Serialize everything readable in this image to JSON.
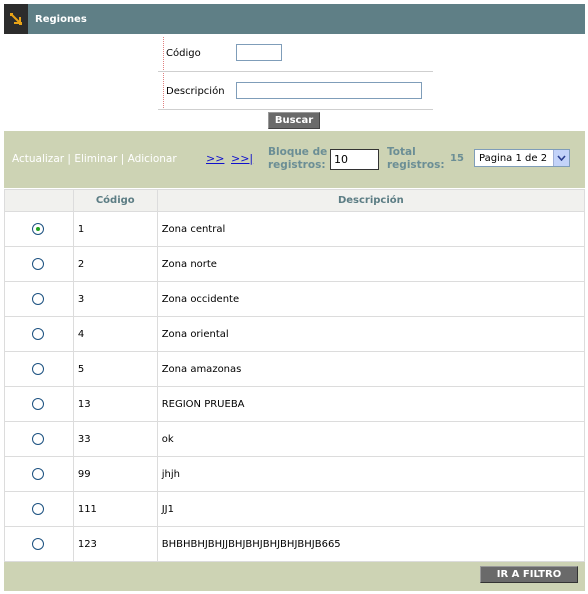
{
  "header": {
    "title": "Regiones",
    "icon": "arrow-down-right-icon"
  },
  "filter": {
    "codigo_label": "Código",
    "codigo_value": "",
    "descripcion_label": "Descripción",
    "descripcion_value": "",
    "buscar_label": "Buscar"
  },
  "toolbar": {
    "actualizar": "Actualizar",
    "eliminar": "Eliminar",
    "adicionar": "Adicionar",
    "sep": "|",
    "next": ">>",
    "last": ">>|",
    "bloque_label_1": "Bloque de",
    "bloque_label_2": "registros:",
    "bloque_value": "10",
    "total_label_1": "Total",
    "total_label_2": "registros:",
    "total_value": "15",
    "page_select": "Pagina 1 de 2"
  },
  "table": {
    "headers": [
      "",
      "Código",
      "Descripción"
    ],
    "rows": [
      {
        "codigo": "1",
        "descripcion": "Zona central",
        "selected": true
      },
      {
        "codigo": "2",
        "descripcion": "Zona norte",
        "selected": false
      },
      {
        "codigo": "3",
        "descripcion": "Zona occidente",
        "selected": false
      },
      {
        "codigo": "4",
        "descripcion": "Zona oriental",
        "selected": false
      },
      {
        "codigo": "5",
        "descripcion": "Zona amazonas",
        "selected": false
      },
      {
        "codigo": "13",
        "descripcion": "REGION PRUEBA",
        "selected": false
      },
      {
        "codigo": "33",
        "descripcion": "ok",
        "selected": false
      },
      {
        "codigo": "99",
        "descripcion": "jhjh",
        "selected": false
      },
      {
        "codigo": "111",
        "descripcion": "JJ1",
        "selected": false
      },
      {
        "codigo": "123",
        "descripcion": "BHBHBHJBHJJBHJBHJBHJBHJBHJB665",
        "selected": false
      }
    ]
  },
  "footer": {
    "ir_filtro_label": "IR A FILTRO"
  },
  "colors": {
    "header_bg": "#5f7f86",
    "toolbar_bg": "#cdd3b4",
    "label_teal": "#6b8e95",
    "link_blue": "#1010cc",
    "button_gray": "#6a6a6a"
  }
}
